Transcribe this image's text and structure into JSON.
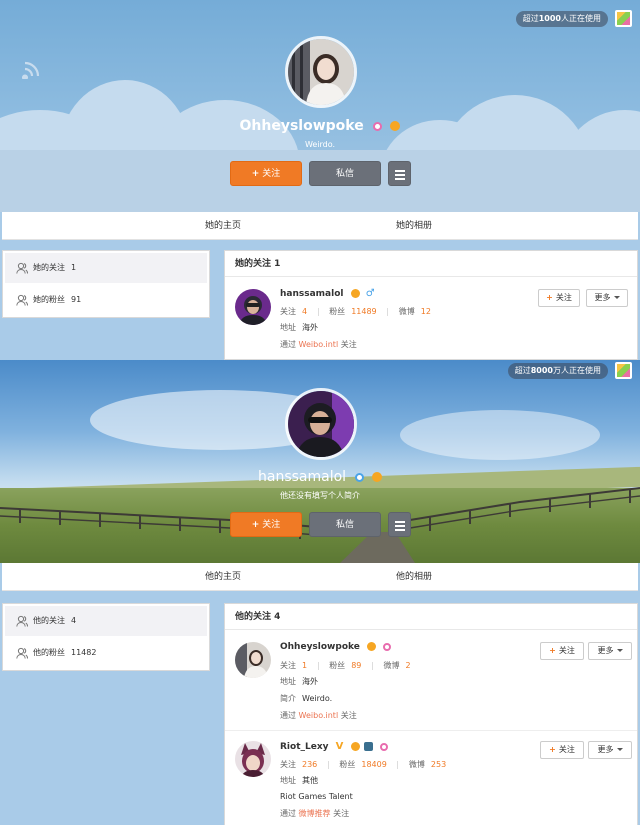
{
  "profile1": {
    "user_count_prefix": "超过",
    "user_count_number": "1000",
    "user_count_suffix": "人正在使用",
    "username": "Ohheyslowpoke",
    "bio": "Weirdo.",
    "follow_label": "关注",
    "message_label": "私信",
    "tabs": [
      "她的主页",
      "她的相册"
    ],
    "sidebar": [
      {
        "label": "她的关注",
        "count": "1"
      },
      {
        "label": "她的粉丝",
        "count": "91"
      }
    ],
    "list_title": "她的关注 1",
    "following": [
      {
        "name": "hanssamalol",
        "stats": {
          "following_label": "关注",
          "following": "4",
          "fans_label": "粉丝",
          "fans": "11489",
          "weibo_label": "微博",
          "weibo": "12"
        },
        "location_label": "地址",
        "location": "海外",
        "via_prefix": "通过",
        "via_link": "Weibo.intl",
        "via_suffix": "关注",
        "follow_label": "关注",
        "more_label": "更多"
      }
    ]
  },
  "profile2": {
    "user_count_prefix": "超过",
    "user_count_number": "8000",
    "user_count_suffix": "万人正在使用",
    "username": "hanssamalol",
    "bio": "他还没有填写个人简介",
    "follow_label": "关注",
    "message_label": "私信",
    "tabs": [
      "他的主页",
      "他的相册"
    ],
    "sidebar": [
      {
        "label": "他的关注",
        "count": "4"
      },
      {
        "label": "他的粉丝",
        "count": "11482"
      }
    ],
    "list_title": "他的关注 4",
    "following": [
      {
        "name": "Ohheyslowpoke",
        "stats": {
          "following_label": "关注",
          "following": "1",
          "fans_label": "粉丝",
          "fans": "89",
          "weibo_label": "微博",
          "weibo": "2"
        },
        "location_label": "地址",
        "location": "海外",
        "intro_label": "简介",
        "intro": "Weirdo.",
        "via_prefix": "通过",
        "via_link": "Weibo.intl",
        "via_suffix": "关注",
        "follow_label": "关注",
        "more_label": "更多"
      },
      {
        "name": "Riot_Lexy",
        "stats": {
          "following_label": "关注",
          "following": "236",
          "fans_label": "粉丝",
          "fans": "18409",
          "weibo_label": "微博",
          "weibo": "253"
        },
        "location_label": "地址",
        "location": "其他",
        "description": "Riot Games Talent",
        "via_prefix": "通过",
        "via_link": "微博推荐",
        "via_suffix": "关注",
        "follow_label": "关注",
        "more_label": "更多"
      }
    ]
  },
  "colors": {
    "accent_orange": "#f07a25",
    "link_orange": "#eb7350",
    "gender_male": "#4aa3e8",
    "gender_female": "#e86cae"
  },
  "icons": [
    "wifi-icon",
    "qr-code-icon",
    "gender-female-icon",
    "gender-male-icon",
    "vip-crown-icon",
    "menu-icon",
    "people-icon",
    "verified-v-icon"
  ]
}
